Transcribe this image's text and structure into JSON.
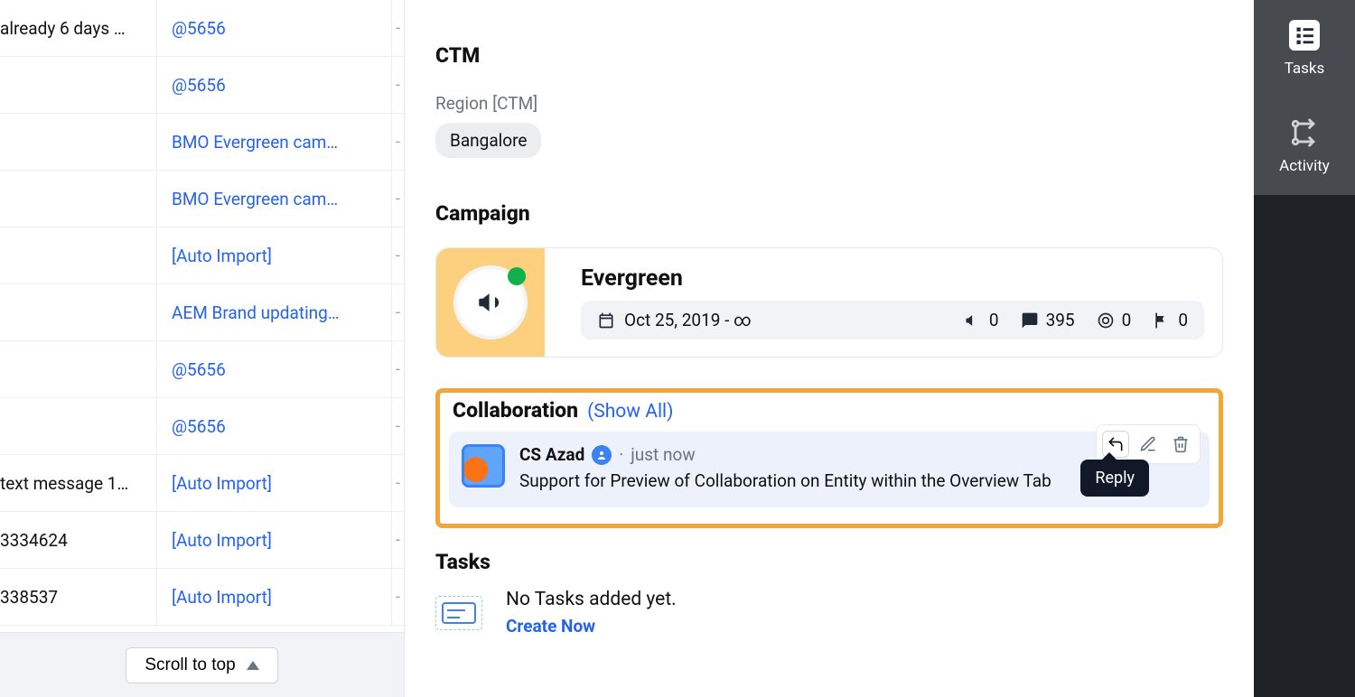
{
  "left_table": {
    "scroll_to_top": "Scroll to top",
    "rows": [
      {
        "a": "already 6 days …",
        "b": "@5656",
        "c": "-"
      },
      {
        "a": "",
        "b": "@5656",
        "c": "-"
      },
      {
        "a": "",
        "b": "BMO Evergreen cam…",
        "c": "-"
      },
      {
        "a": "",
        "b": "BMO Evergreen cam…",
        "c": "-"
      },
      {
        "a": "",
        "b": "[Auto Import]",
        "c": "-"
      },
      {
        "a": "",
        "b": "AEM Brand updating…",
        "c": "-"
      },
      {
        "a": "",
        "b": "@5656",
        "c": "-"
      },
      {
        "a": "",
        "b": "@5656",
        "c": "-"
      },
      {
        "a": "text message 1…",
        "b": "[Auto Import]",
        "c": "-"
      },
      {
        "a": "3334624",
        "b": "[Auto Import]",
        "c": "-"
      },
      {
        "a": "338537",
        "b": "[Auto Import]",
        "c": "-"
      }
    ]
  },
  "panel": {
    "ctm": {
      "title": "CTM",
      "field_label": "Region [CTM]",
      "chip": "Bangalore"
    },
    "campaign": {
      "title": "Campaign",
      "name": "Evergreen",
      "date_range": "Oct 25, 2019 - ∞",
      "stats": {
        "megaphone": "0",
        "comments": "395",
        "target": "0",
        "flag": "0"
      }
    },
    "collaboration": {
      "title": "Collaboration",
      "show_all": "(Show All)",
      "author": "CS Azad",
      "time_prefix": "·",
      "time": "just now",
      "message": "Support for Preview of Collaboration on Entity within the Overview Tab",
      "tooltip": "Reply"
    },
    "tasks": {
      "title": "Tasks",
      "empty": "No Tasks added yet.",
      "create": "Create Now"
    }
  },
  "rail": {
    "tasks": "Tasks",
    "activity": "Activity"
  }
}
